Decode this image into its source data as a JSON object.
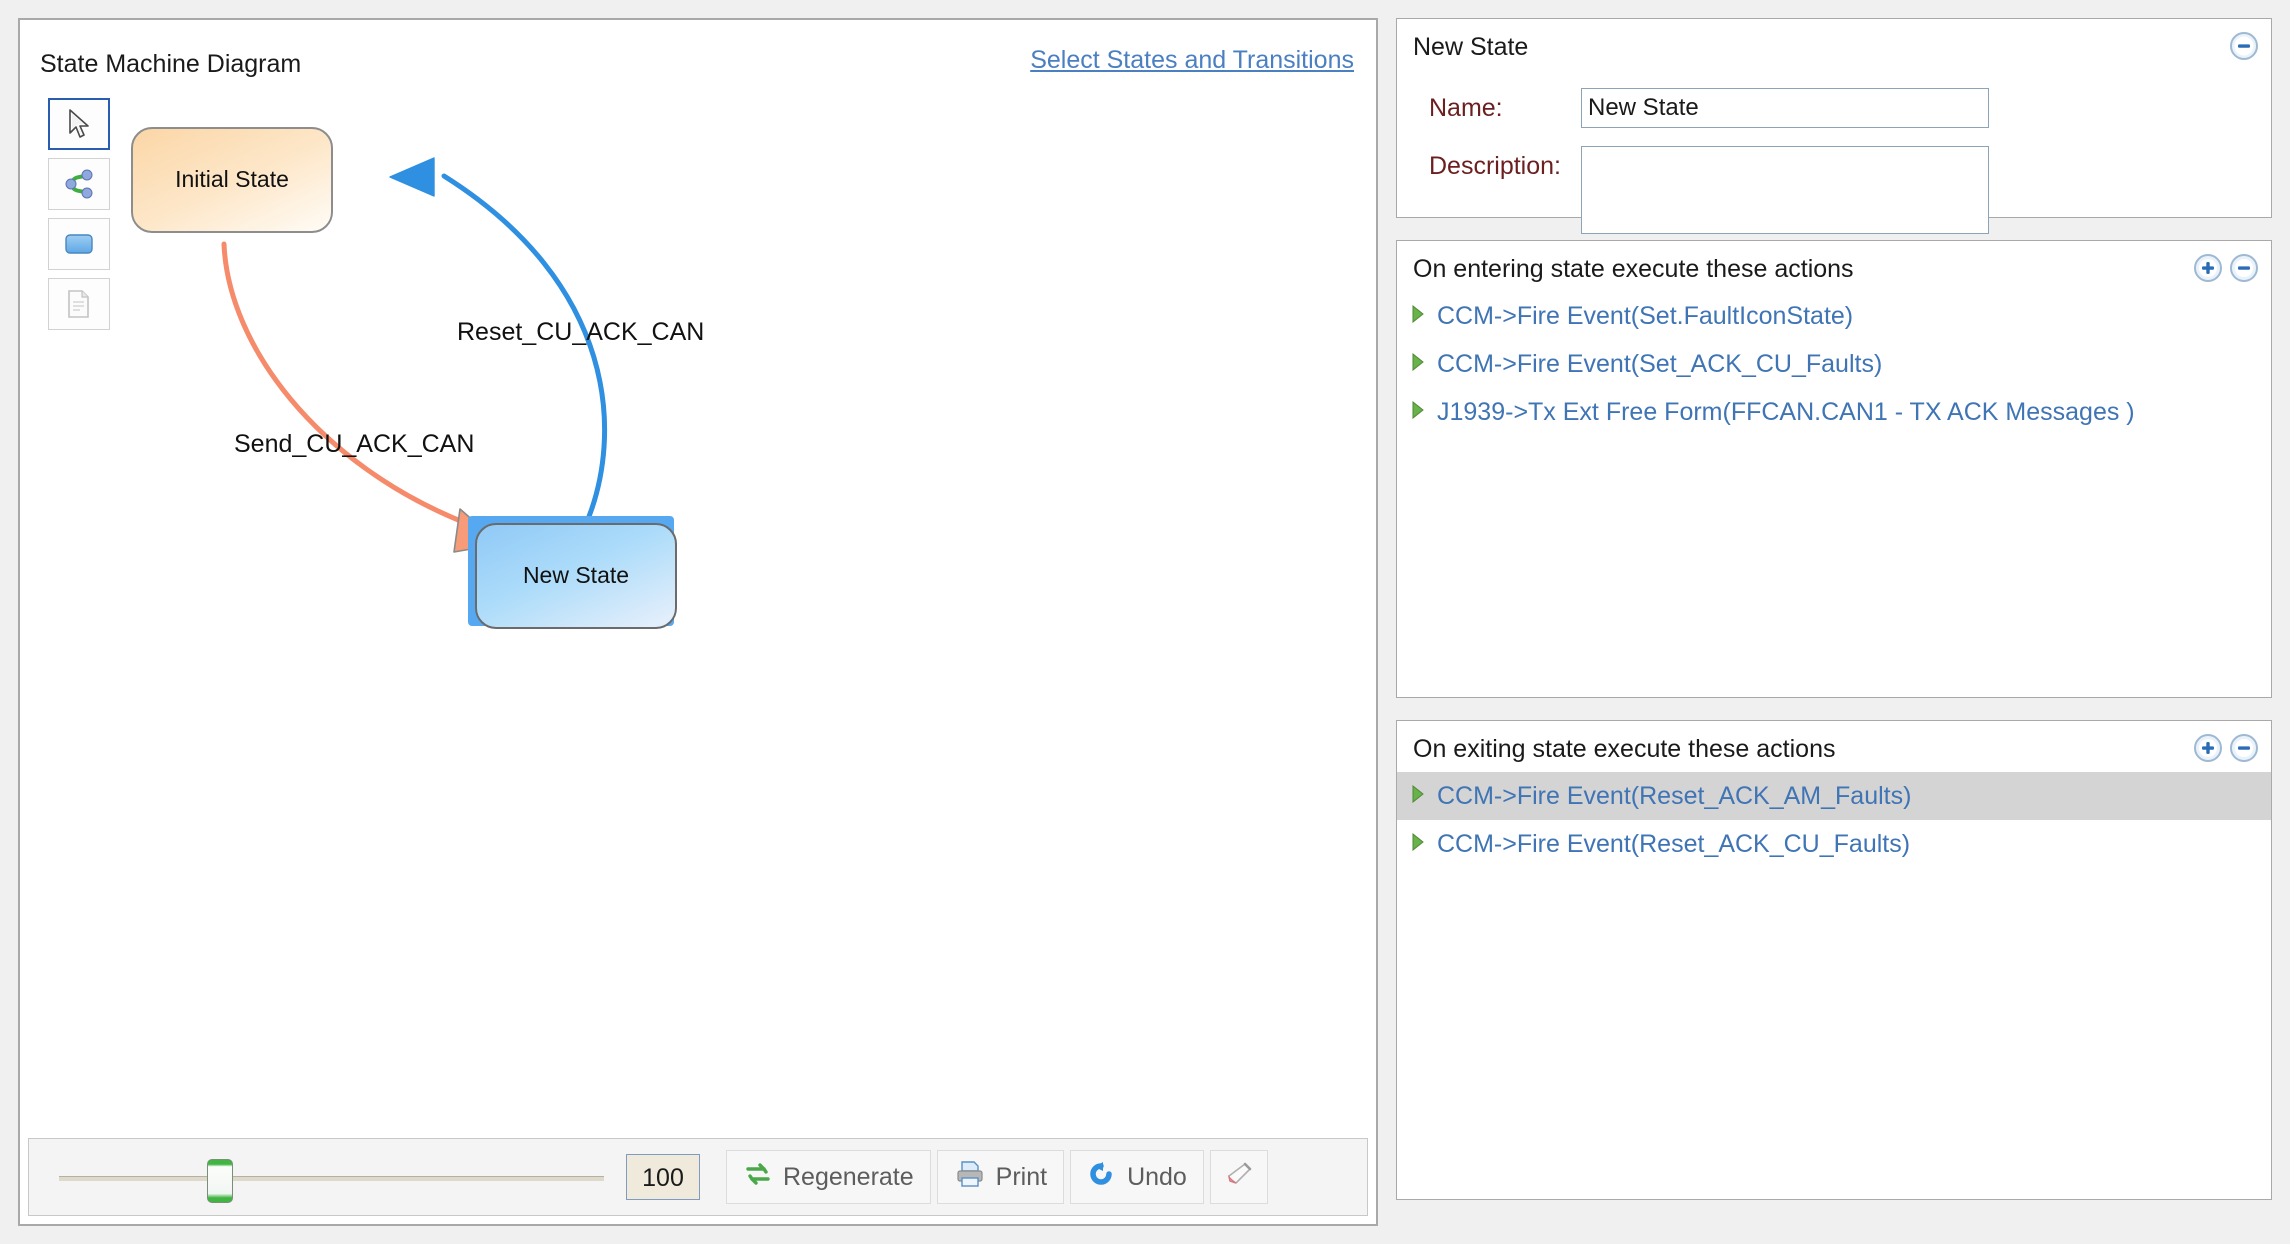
{
  "diagram": {
    "title": "State Machine Diagram",
    "select_link": "Select States and Transitions",
    "palette": [
      {
        "name": "pointer-tool",
        "icon": "cursor-arrow-icon",
        "selected": true
      },
      {
        "name": "transition-tool",
        "icon": "transition-node-icon",
        "selected": false
      },
      {
        "name": "state-tool",
        "icon": "state-box-icon",
        "selected": false
      },
      {
        "name": "note-tool",
        "icon": "note-page-icon",
        "selected": false
      }
    ],
    "nodes": [
      {
        "id": "initial",
        "label": "Initial State",
        "selected": false,
        "fill": "#fde3c0"
      },
      {
        "id": "new",
        "label": "New State",
        "selected": true,
        "fill": "#a9d4f5"
      }
    ],
    "transitions": [
      {
        "id": "t1",
        "label": "Send_CU_ACK_CAN",
        "from": "initial",
        "to": "new",
        "color": "#f58b6b"
      },
      {
        "id": "t2",
        "label": "Reset_CU_ACK_CAN",
        "from": "new",
        "to": "initial",
        "color": "#2f8fe0"
      }
    ]
  },
  "toolbar": {
    "zoom_value": "100",
    "buttons": [
      {
        "label": "Regenerate",
        "icon": "regenerate-icon"
      },
      {
        "label": "Print",
        "icon": "printer-icon"
      },
      {
        "label": "Undo",
        "icon": "undo-icon"
      },
      {
        "label": "",
        "icon": "eraser-icon"
      }
    ]
  },
  "state_panel": {
    "title": "New State",
    "collapse_icon": "minus-circle-icon",
    "name_label": "Name:",
    "name_value": "New State",
    "description_label": "Description:",
    "description_value": ""
  },
  "entering_panel": {
    "title": "On entering state execute these actions",
    "add_icon": "plus-circle-icon",
    "remove_icon": "minus-circle-icon",
    "actions": [
      {
        "text": "CCM->Fire Event(Set.FaultIconState)",
        "selected": false
      },
      {
        "text": "CCM->Fire Event(Set_ACK_CU_Faults)",
        "selected": false
      },
      {
        "text": "J1939->Tx Ext Free Form(FFCAN.CAN1 - TX ACK Messages )",
        "selected": false
      }
    ]
  },
  "exiting_panel": {
    "title": "On exiting state execute these actions",
    "add_icon": "plus-circle-icon",
    "remove_icon": "minus-circle-icon",
    "actions": [
      {
        "text": "CCM->Fire Event(Reset_ACK_AM_Faults)",
        "selected": true
      },
      {
        "text": "CCM->Fire Event(Reset_ACK_CU_Faults)",
        "selected": false
      }
    ]
  },
  "colors": {
    "link": "#4a7fc1",
    "label_maroon": "#6b1f1f",
    "action_blue": "#3f74b5",
    "selection_gray": "#d4d4d4",
    "transition_orange": "#f58b6b",
    "transition_blue": "#2f8fe0"
  }
}
